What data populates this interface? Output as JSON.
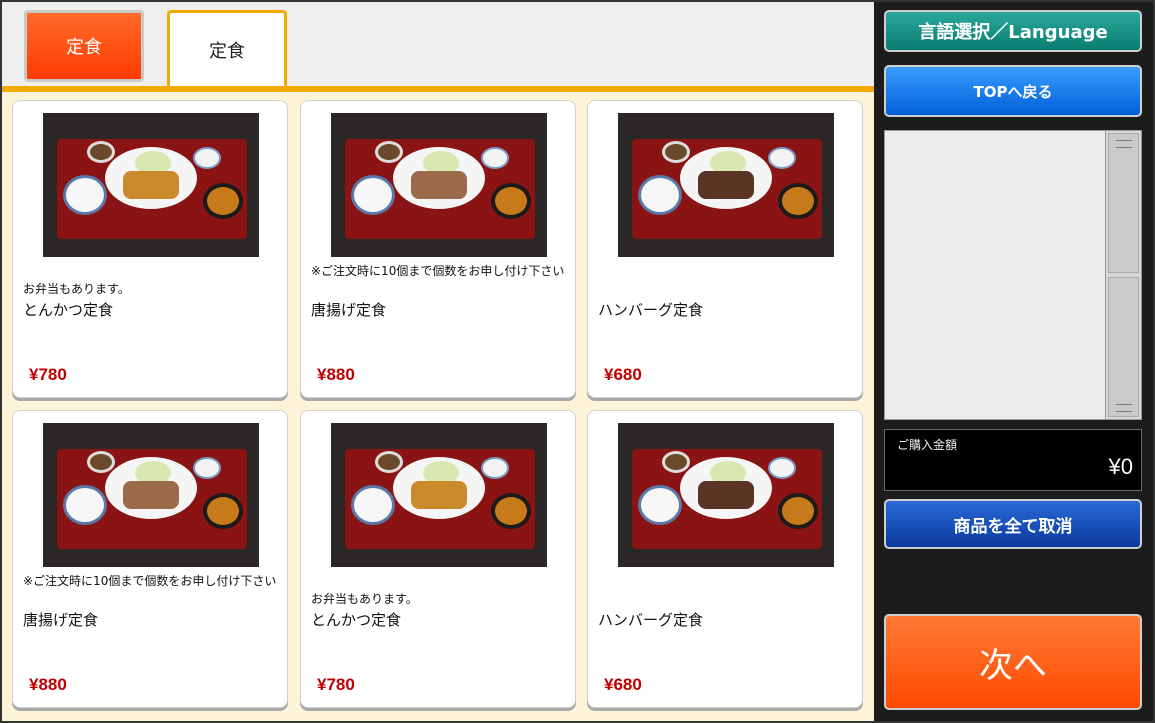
{
  "tabs": [
    {
      "label": "定食",
      "state": "inactive",
      "color": "#ff4a00"
    },
    {
      "label": "定食",
      "state": "active"
    }
  ],
  "menu": {
    "items": [
      {
        "note": "お弁当もあります。",
        "name": "とんかつ定食",
        "price": "¥780",
        "image": "tonkatsu-set-photo"
      },
      {
        "note": "※ご注文時に10個まで個数をお申し付け下さい",
        "name": "唐揚げ定食",
        "price": "¥880",
        "image": "karaage-set-photo"
      },
      {
        "note": "",
        "name": "ハンバーグ定食",
        "price": "¥680",
        "image": "hamburg-set-photo"
      },
      {
        "note": "※ご注文時に10個まで個数をお申し付け下さい",
        "name": "唐揚げ定食",
        "price": "¥880",
        "image": "karaage-set-photo"
      },
      {
        "note": "お弁当もあります。",
        "name": "とんかつ定食",
        "price": "¥780",
        "image": "tonkatsu-set-photo"
      },
      {
        "note": "",
        "name": "ハンバーグ定食",
        "price": "¥680",
        "image": "hamburg-set-photo"
      }
    ],
    "price_color": "#c00000"
  },
  "sidebar": {
    "language_label": "言語選択／Language",
    "top_label": "TOPへ戻る",
    "cart_items": [],
    "total_label": "ご購入金額",
    "total_value": "¥0",
    "cancel_all_label": "商品を全て取消",
    "next_label": "次へ"
  },
  "colors": {
    "accent_orange": "#ff4a00",
    "tab_underline": "#f2a900",
    "lang_button": "#0b7d72",
    "top_button": "#0060d8",
    "cancel_button": "#0a3a9c"
  }
}
